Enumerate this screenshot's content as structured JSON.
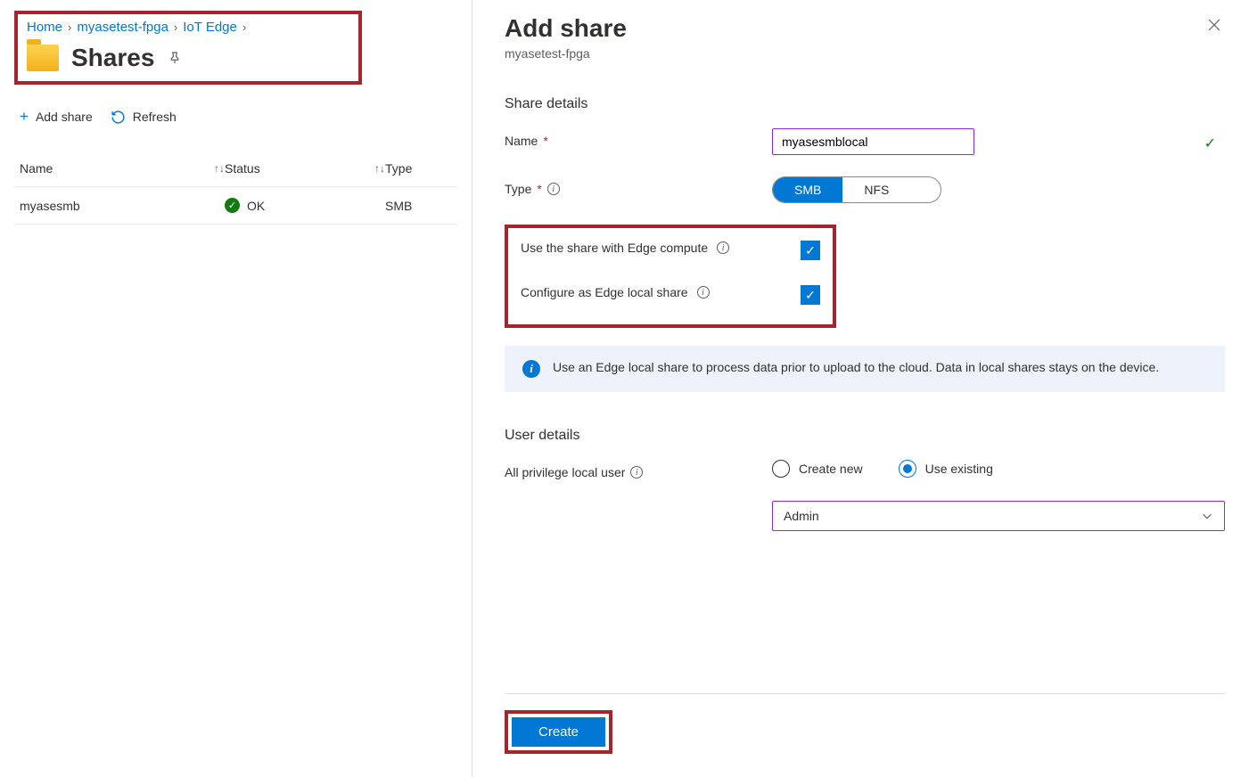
{
  "breadcrumb": {
    "home": "Home",
    "device": "myasetest-fpga",
    "feature": "IoT Edge"
  },
  "page": {
    "title": "Shares"
  },
  "toolbar": {
    "add_share": "Add share",
    "refresh": "Refresh"
  },
  "table": {
    "head_name": "Name",
    "head_status": "Status",
    "head_type": "Type",
    "rows": [
      {
        "name": "myasesmb",
        "status": "OK",
        "type": "SMB"
      }
    ]
  },
  "panel": {
    "title": "Add share",
    "subtitle": "myasetest-fpga",
    "section_share": "Share details",
    "label_name": "Name",
    "name_value": "myasesmblocal",
    "label_type": "Type",
    "type_options": {
      "smb": "SMB",
      "nfs": "NFS"
    },
    "label_use_edge": "Use the share with Edge compute",
    "label_local_share": "Configure as Edge local share",
    "info_text": "Use an Edge local share to process data prior to upload to the cloud. Data in local shares stays on the device.",
    "section_user": "User details",
    "label_user": "All privilege local user",
    "radio_create": "Create new",
    "radio_existing": "Use existing",
    "select_value": "Admin",
    "create_button": "Create"
  }
}
